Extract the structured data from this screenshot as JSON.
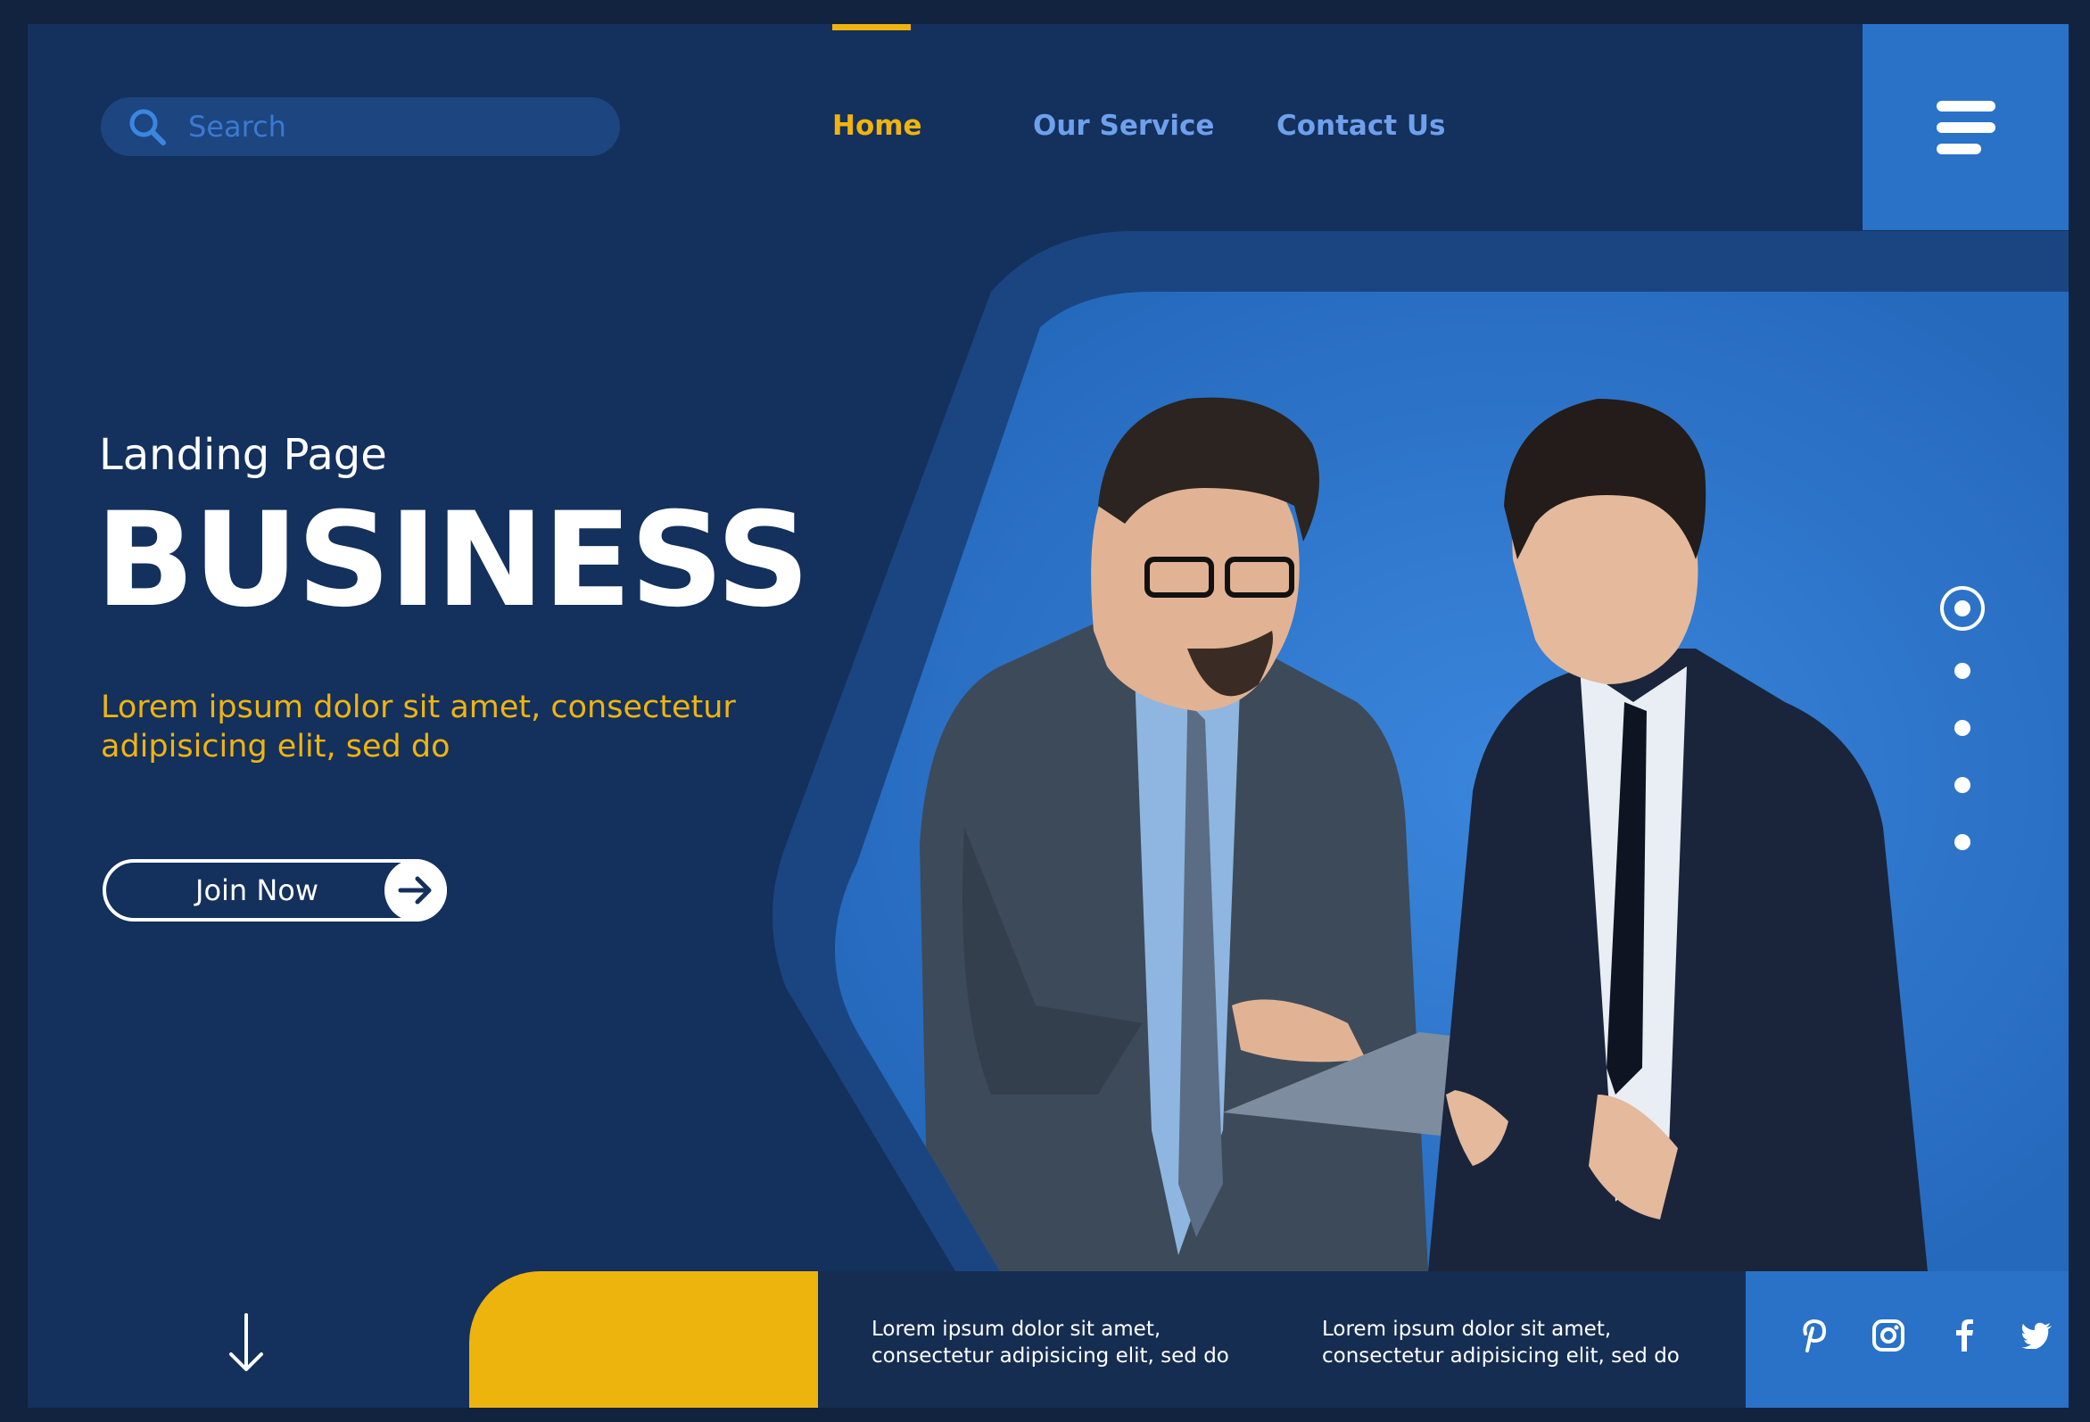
{
  "search": {
    "placeholder": "Search",
    "icon": "search-icon"
  },
  "nav": {
    "items": [
      {
        "label": "Home",
        "active": true
      },
      {
        "label": "Our Service",
        "active": false
      },
      {
        "label": "Contact Us",
        "active": false
      }
    ],
    "menu_icon": "hamburger-menu-icon"
  },
  "hero": {
    "subtitle": "Landing Page",
    "title": "BUSINESS",
    "lead": "Lorem ipsum dolor sit amet, consectetur adipisicing elit, sed do",
    "cta_label": "Join Now",
    "cta_icon": "arrow-right-icon",
    "image": "two-businessmen-reviewing-clipboard"
  },
  "slider": {
    "count": 5,
    "active_index": 0
  },
  "footer": {
    "scroll_icon": "arrow-down-icon",
    "info_1": "Lorem ipsum dolor sit amet,\nconsectetur adipisicing elit, sed do",
    "info_2": "Lorem ipsum dolor sit amet,\nconsectetur adipisicing elit, sed do",
    "social": [
      "pinterest-icon",
      "instagram-icon",
      "facebook-icon",
      "twitter-icon"
    ]
  },
  "colors": {
    "background": "#14305c",
    "accent": "#f0b40e",
    "primary_blue": "#2a72c7",
    "nav_link": "#6ea0ec"
  }
}
